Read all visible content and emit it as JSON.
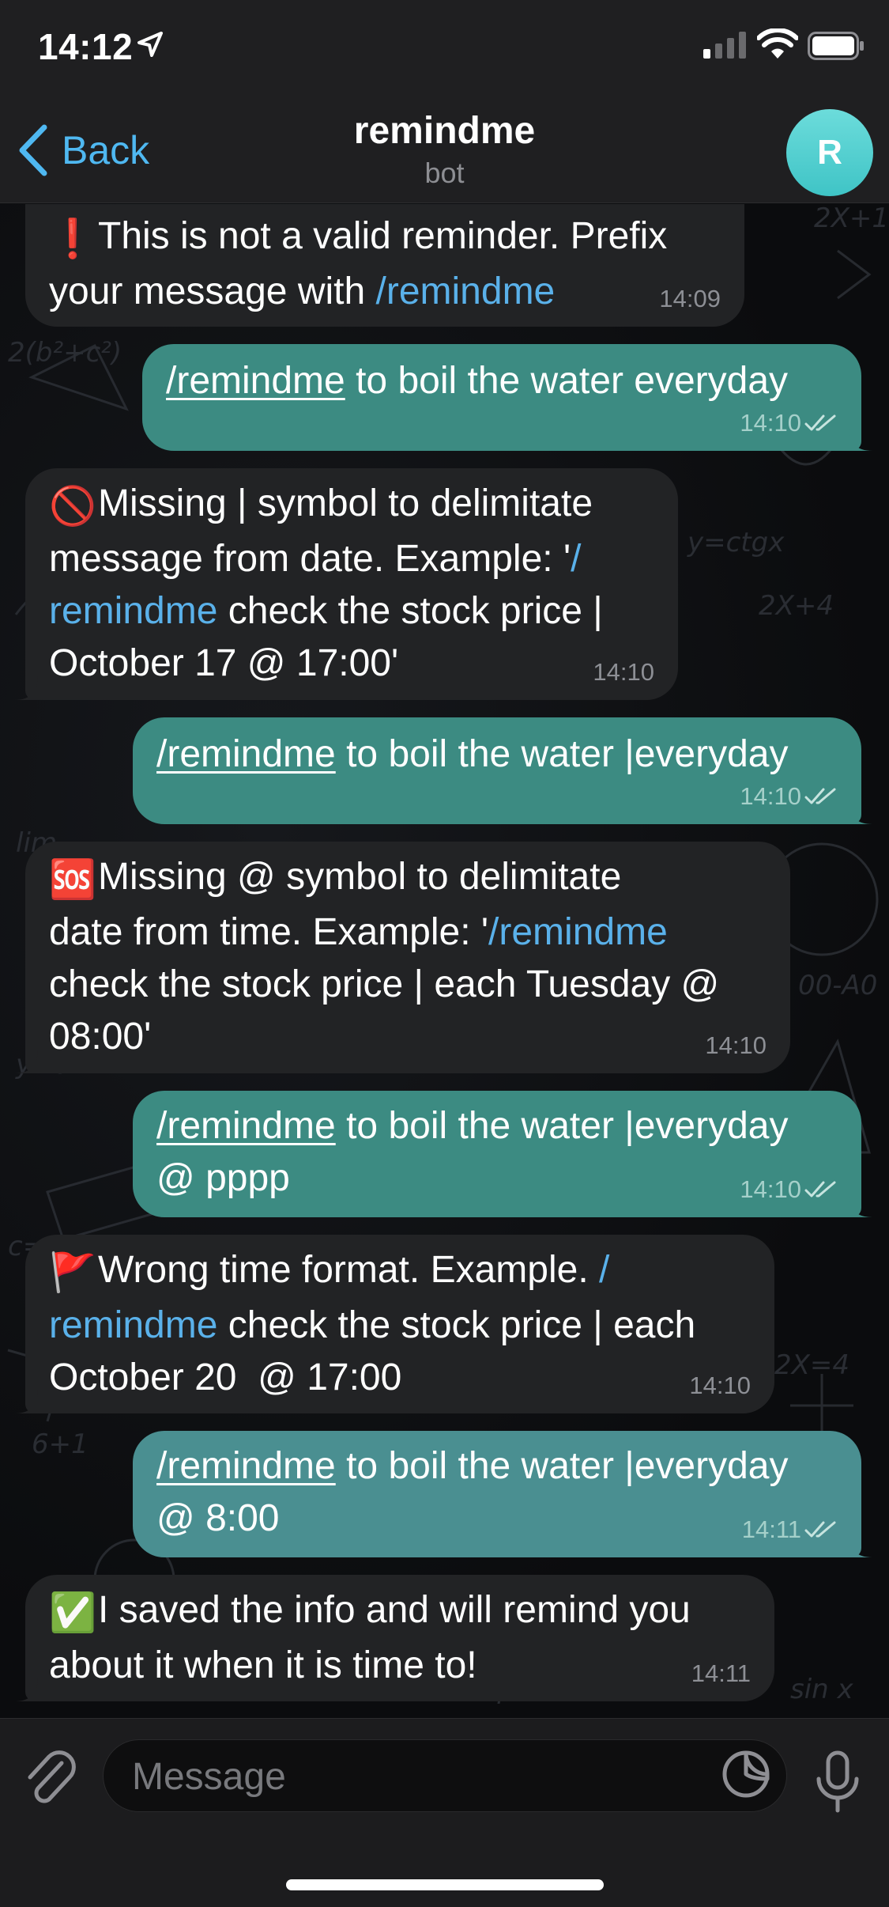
{
  "status_bar": {
    "time": "14:12"
  },
  "header": {
    "back_label": "Back",
    "title": "remindme",
    "subtitle": "bot",
    "avatar_letter": "R"
  },
  "colors": {
    "accent": "#4fb8f1",
    "outgoing_bubble": "#3c8b82",
    "incoming_bubble": "#222325",
    "avatar": "#4fcacb"
  },
  "messages": [
    {
      "direction": "in",
      "emoji": "❗",
      "time": "14:09",
      "lines": [
        "This is not a valid reminder. Prefix",
        "your message with "
      ],
      "command": "/remindme"
    },
    {
      "direction": "out",
      "command": "/remindme",
      "text": " to boil the water everyday",
      "time": "14:10"
    },
    {
      "direction": "in",
      "emoji": "🚫",
      "time": "14:10",
      "line1": "Missing | symbol to delimitate",
      "line2_text": "message from date. Example: '",
      "line2_cmd": "/",
      "line3_cmd": "remindme",
      "line3_text": " check the stock price |",
      "line4": "October 17 @ 17:00'"
    },
    {
      "direction": "out",
      "command": "/remindme",
      "text": " to boil the water |everyday",
      "time": "14:10"
    },
    {
      "direction": "in",
      "emoji": "🆘",
      "time": "14:10",
      "line1": "Missing @ symbol to delimitate",
      "line2_text": "date from time. Example: '",
      "line2_cmd": "/remindme",
      "line3": "check the stock price | each Tuesday @",
      "line4": "08:00'"
    },
    {
      "direction": "out",
      "command": "/remindme",
      "text": " to boil the water |everyday",
      "line2": "@ pppp",
      "time": "14:10"
    },
    {
      "direction": "in",
      "emoji": "🚩",
      "time": "14:10",
      "line1_text": "Wrong time format. Example. ",
      "line1_cmd": "/",
      "line2_cmd": "remindme",
      "line2_text": " check the stock price | each",
      "line3": "October 20  @ 17:00"
    },
    {
      "direction": "out",
      "command": "/remindme",
      "text": " to boil the water |everyday",
      "line2": "@ 8:00",
      "time": "14:11"
    },
    {
      "direction": "in",
      "emoji": "✅",
      "time": "14:11",
      "line1": "I saved the info and will remind you",
      "line2": "about it when it is time to!"
    }
  ],
  "input": {
    "placeholder": "Message"
  }
}
